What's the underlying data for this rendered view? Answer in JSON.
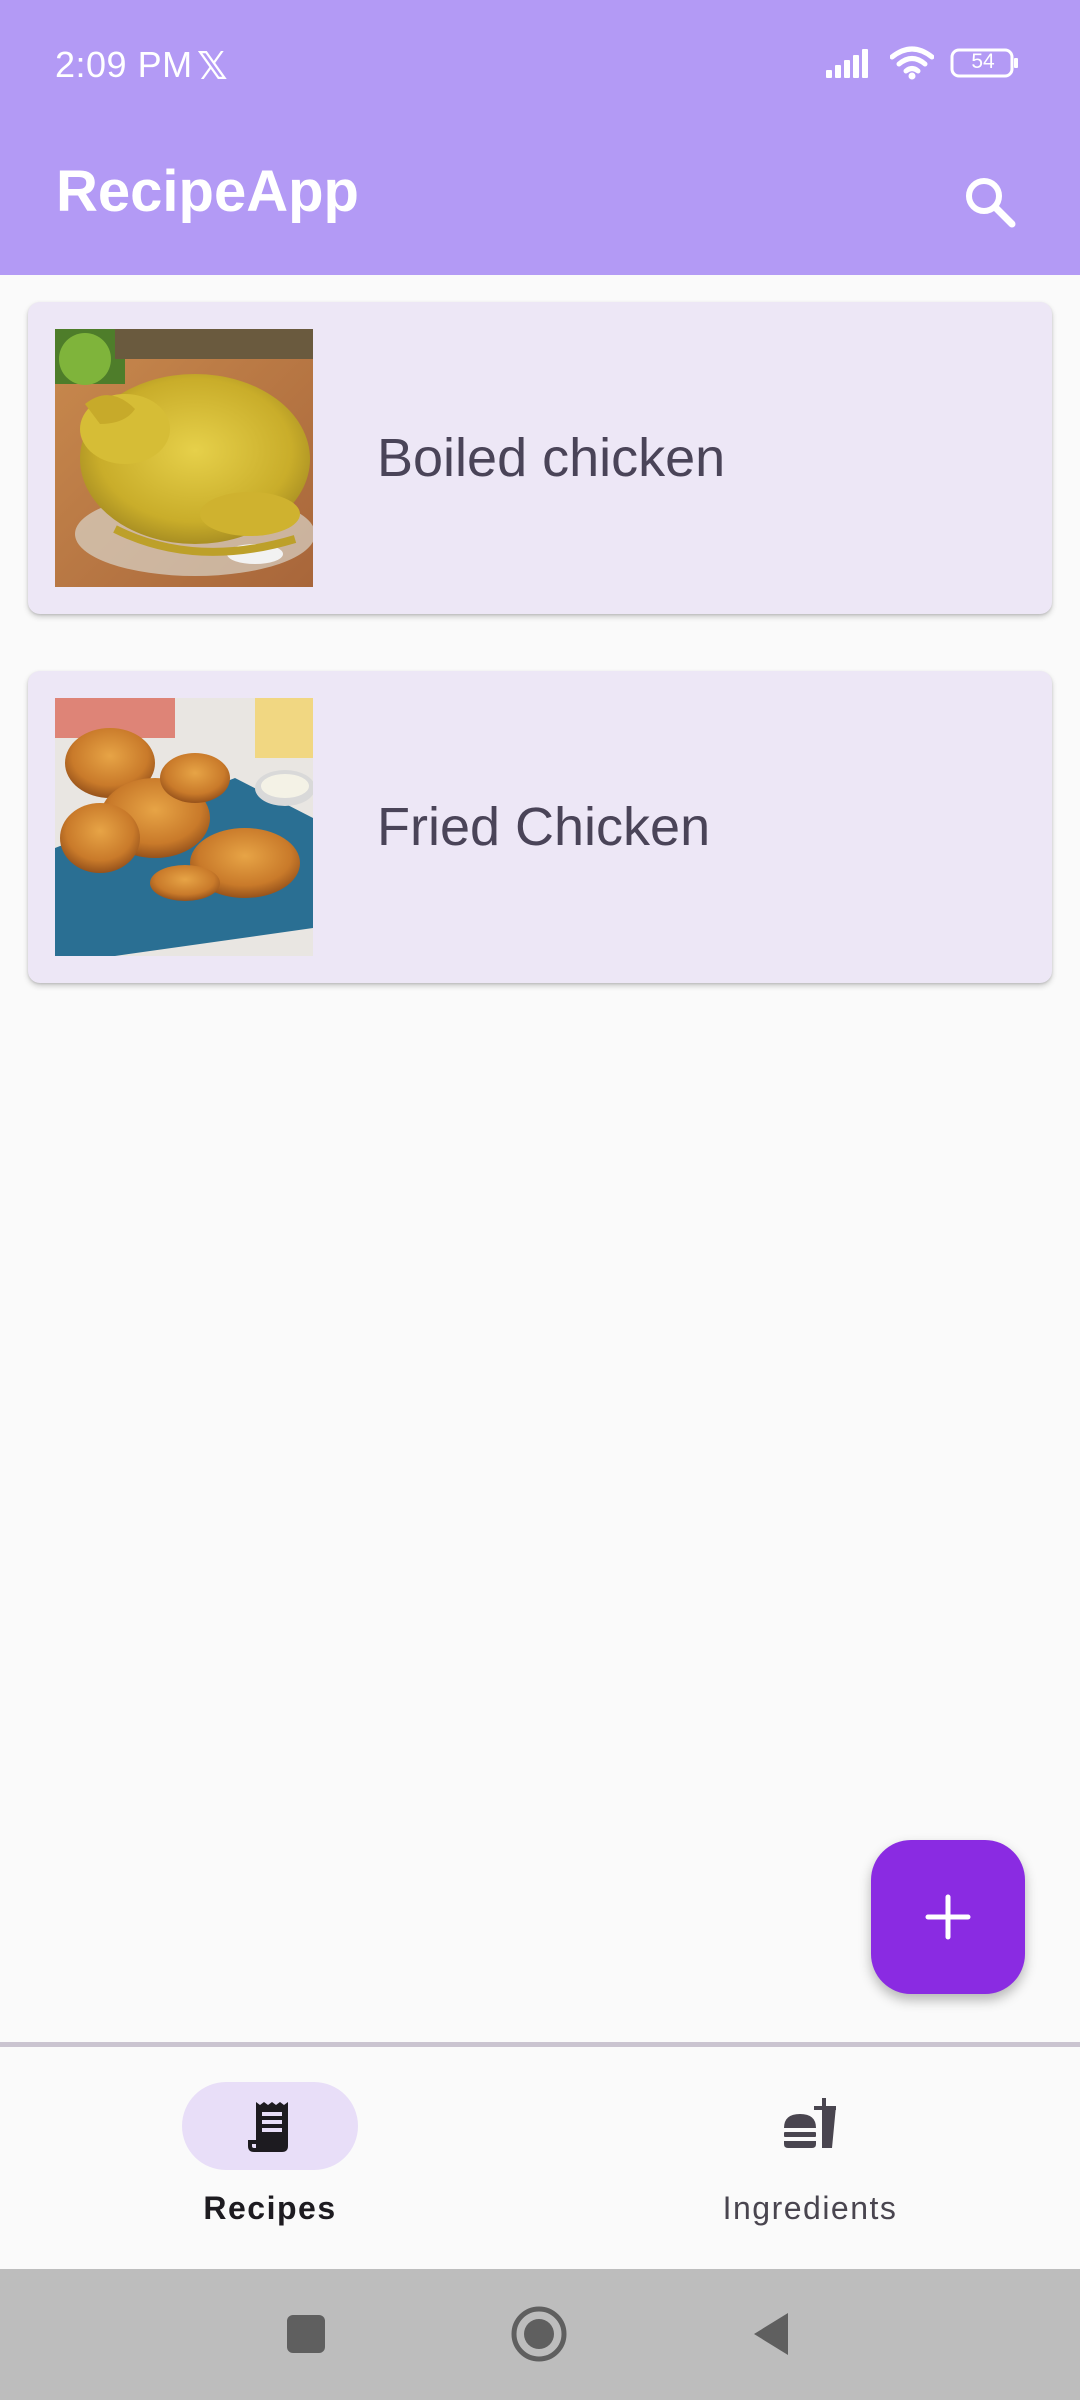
{
  "status_bar": {
    "time": "2:09 PM",
    "notification_icon": "x-logo-icon",
    "battery_level": "54"
  },
  "app_bar": {
    "title": "RecipeApp",
    "search_icon": "search-icon"
  },
  "recipes": [
    {
      "name": "Boiled chicken",
      "image": "boiled-chicken-photo"
    },
    {
      "name": "Fried Chicken",
      "image": "fried-chicken-photo"
    }
  ],
  "fab": {
    "icon": "plus-icon"
  },
  "bottom_nav": {
    "items": [
      {
        "label": "Recipes",
        "icon": "receipt-icon",
        "active": true
      },
      {
        "label": "Ingredients",
        "icon": "fastfood-icon",
        "active": false
      }
    ]
  },
  "system_nav": {
    "buttons": [
      "recents-icon",
      "home-icon",
      "back-icon"
    ]
  },
  "colors": {
    "app_bar": "#b39af5",
    "card_background": "#ede7f6",
    "fab": "#8a2be2",
    "nav_indicator": "#e8def8",
    "system_nav": "#bdbdbd"
  }
}
